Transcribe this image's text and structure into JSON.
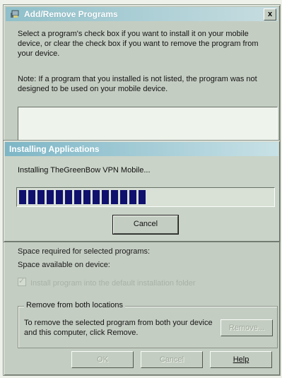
{
  "window": {
    "title": "Add/Remove Programs",
    "close_label": "x",
    "intro_text": "Select a program's check box if you want to install it on your mobile device, or clear the check box if you want to remove the program from your device.",
    "note_text": "Note:  If a program that you installed is not listed, the program was not designed to be used on your mobile device.",
    "space_required_label": "Space required for selected programs:",
    "space_available_label": "Space available on device:",
    "default_folder_checkbox_label": "Install program into the default installation folder",
    "default_folder_checked": true,
    "remove_group": {
      "title": "Remove from both locations",
      "text": "To remove the selected program from both your device and this computer, click Remove.",
      "remove_button": "Remove..."
    },
    "buttons": {
      "ok": "OK",
      "cancel": "Cancel",
      "help": "Help"
    }
  },
  "progress_dialog": {
    "title": "Installing Applications",
    "status_text": "Installing TheGreenBow VPN Mobile...",
    "progress_fraction": 0.52,
    "cancel_button": "Cancel",
    "bar_color": "#10106e"
  }
}
